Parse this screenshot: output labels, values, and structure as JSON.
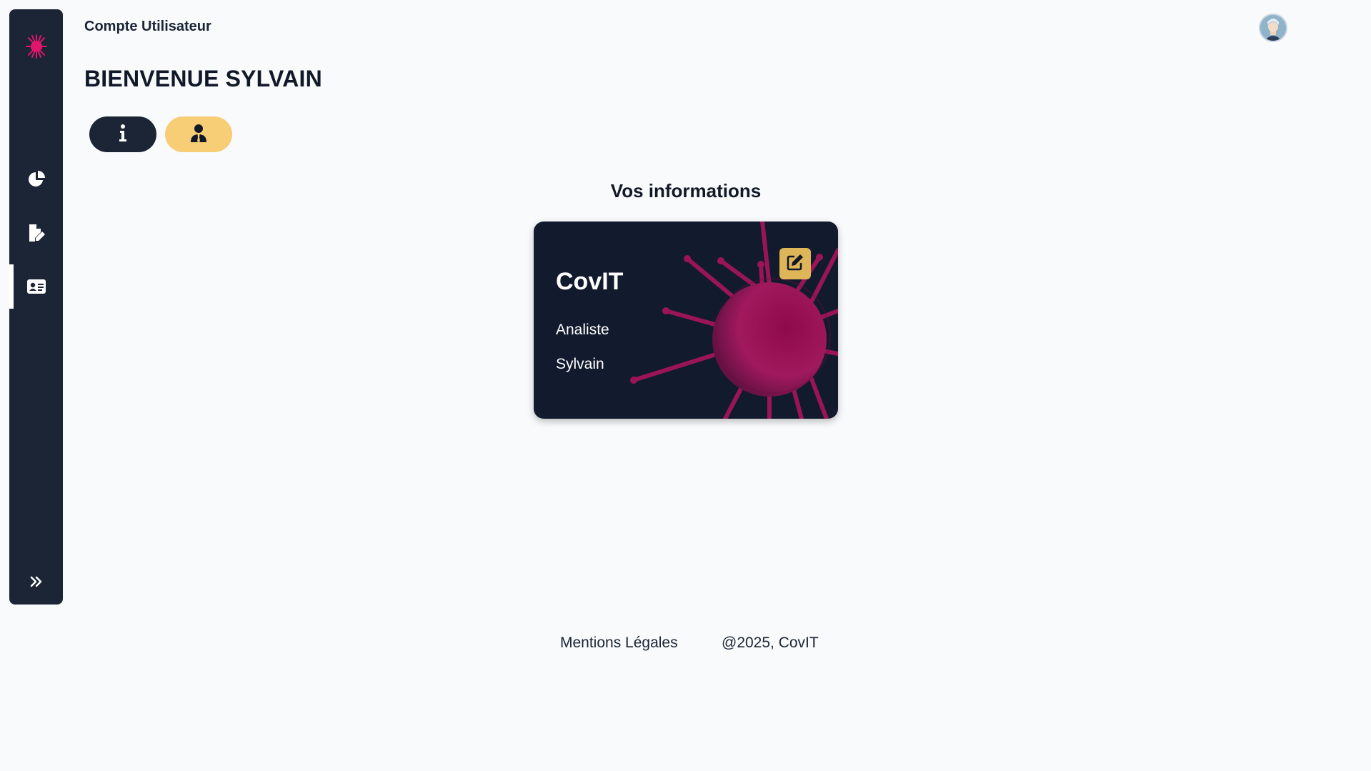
{
  "header": {
    "title": "Compte Utilisateur"
  },
  "main": {
    "welcome": "BIENVENUE SYLVAIN",
    "tabs": [
      {
        "icon": "info-icon"
      },
      {
        "icon": "user-tie-icon"
      }
    ],
    "section_title": "Vos informations",
    "card": {
      "brand": "CovIT",
      "role": "Analiste",
      "name": "Sylvain"
    }
  },
  "sidebar": {
    "items": [
      {
        "icon": "pie-chart-icon"
      },
      {
        "icon": "file-edit-icon"
      },
      {
        "icon": "id-card-icon",
        "active": true
      },
      {
        "icon": "double-chevron-right-icon"
      }
    ]
  },
  "footer": {
    "legal": "Mentions Légales",
    "copyright": "@2025, CovIT"
  },
  "colors": {
    "sidebar": "#1b2535",
    "accent_yellow": "#f7cd76",
    "card_bg": "#121a2e",
    "virus": "#a0195e",
    "logo": "#e0156b"
  }
}
